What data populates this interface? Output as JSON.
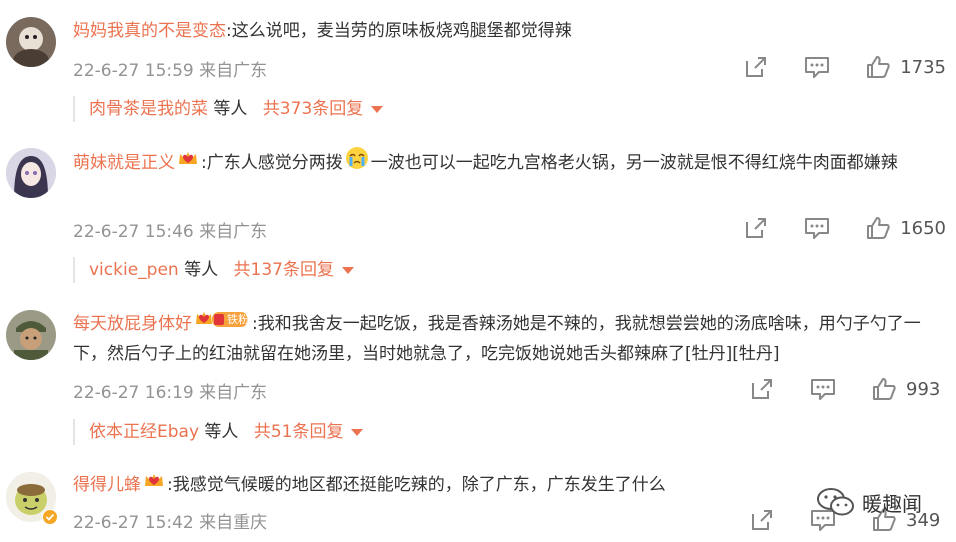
{
  "comments": [
    {
      "username": "妈妈我真的不是变态",
      "text": ":这么说吧，麦当劳的原味板烧鸡腿堡都觉得辣",
      "time": "22-6-27 15:59",
      "location": "来自广东",
      "likes": "1735",
      "reply": {
        "name": "肉骨茶是我的菜",
        "mid": "等人",
        "total": "共373条回复"
      }
    },
    {
      "username": "萌妹就是正义",
      "text_a": ":广东人感觉分两拨",
      "text_b": "一波也可以一起吃九宫格老火锅，另一波就是恨不得红烧牛肉面都嫌辣",
      "time": "22-6-27 15:46",
      "location": "来自广东",
      "likes": "1650",
      "reply": {
        "name": "vickie_pen",
        "mid": "等人",
        "total": "共137条回复"
      }
    },
    {
      "username": "每天放屁身体好",
      "badge_text": "铁粉",
      "text": ":我和我舍友一起吃饭，我是香辣汤她是不辣的，我就想尝尝她的汤底啥味，用勺子勺了一下，然后勺子上的红油就留在她汤里，当时她就急了，吃完饭她说她舌头都辣麻了[牡丹][牡丹]",
      "time": "22-6-27 16:19",
      "location": "来自广东",
      "likes": "993",
      "reply": {
        "name": "依本正经Ebay",
        "mid": "等人",
        "total": "共51条回复"
      }
    },
    {
      "username": "得得儿蜂",
      "text": ":我感觉气候暖的地区都还挺能吃辣的，除了广东，广东发生了什么",
      "time": "22-6-27 15:42",
      "location": "来自重庆",
      "likes": "349"
    }
  ],
  "watermark": "暖趣闻",
  "colors": {
    "username": "#eb7350",
    "meta": "#939393",
    "text": "#333333"
  }
}
